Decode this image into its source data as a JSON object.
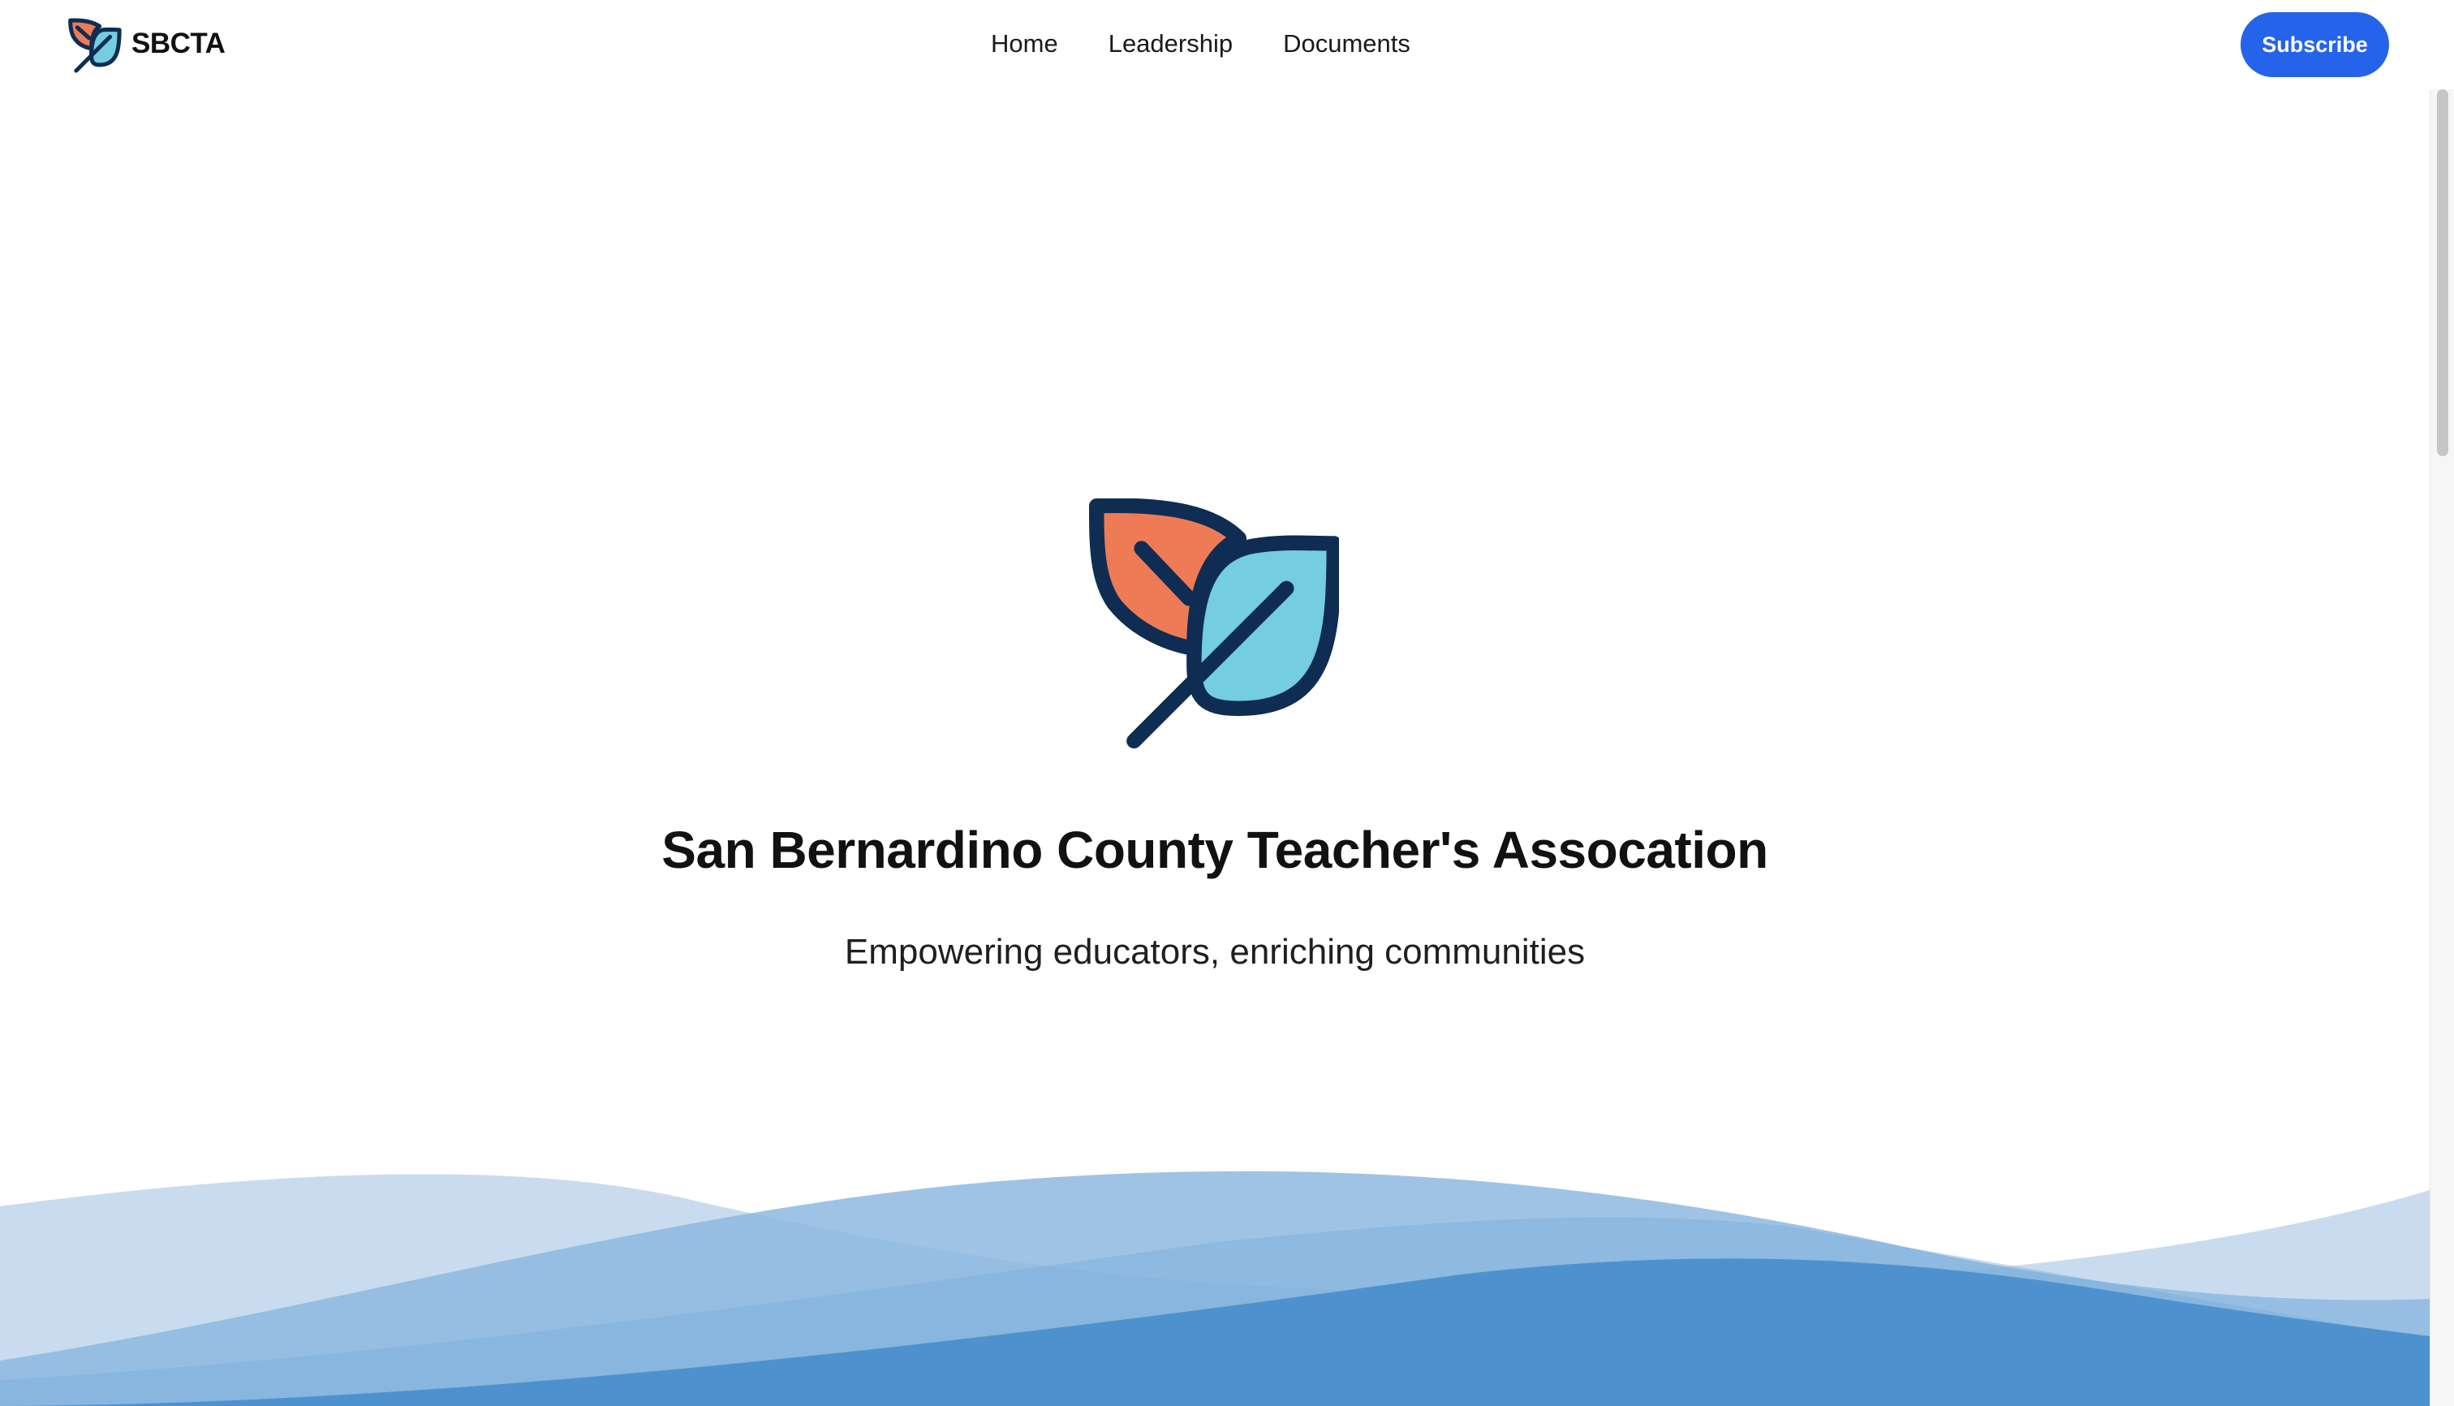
{
  "header": {
    "brand_name": "SBCTA",
    "nav": [
      {
        "label": "Home"
      },
      {
        "label": "Leadership"
      },
      {
        "label": "Documents"
      }
    ],
    "subscribe_label": "Subscribe"
  },
  "hero": {
    "title": "San Bernardino County Teacher's Assocation",
    "subtitle": "Empowering educators, enriching communities"
  },
  "icons": {
    "brand_logo": "leaf-logo-icon",
    "hero_logo": "leaf-logo-icon"
  },
  "colors": {
    "accent": "#2563eb",
    "leaf_orange": "#ee7b55",
    "leaf_blue": "#74cde0",
    "outline": "#0f2d52",
    "wave_light": "#c9dcef",
    "wave_mid": "#8db8df",
    "wave_dark": "#4d92ce"
  }
}
